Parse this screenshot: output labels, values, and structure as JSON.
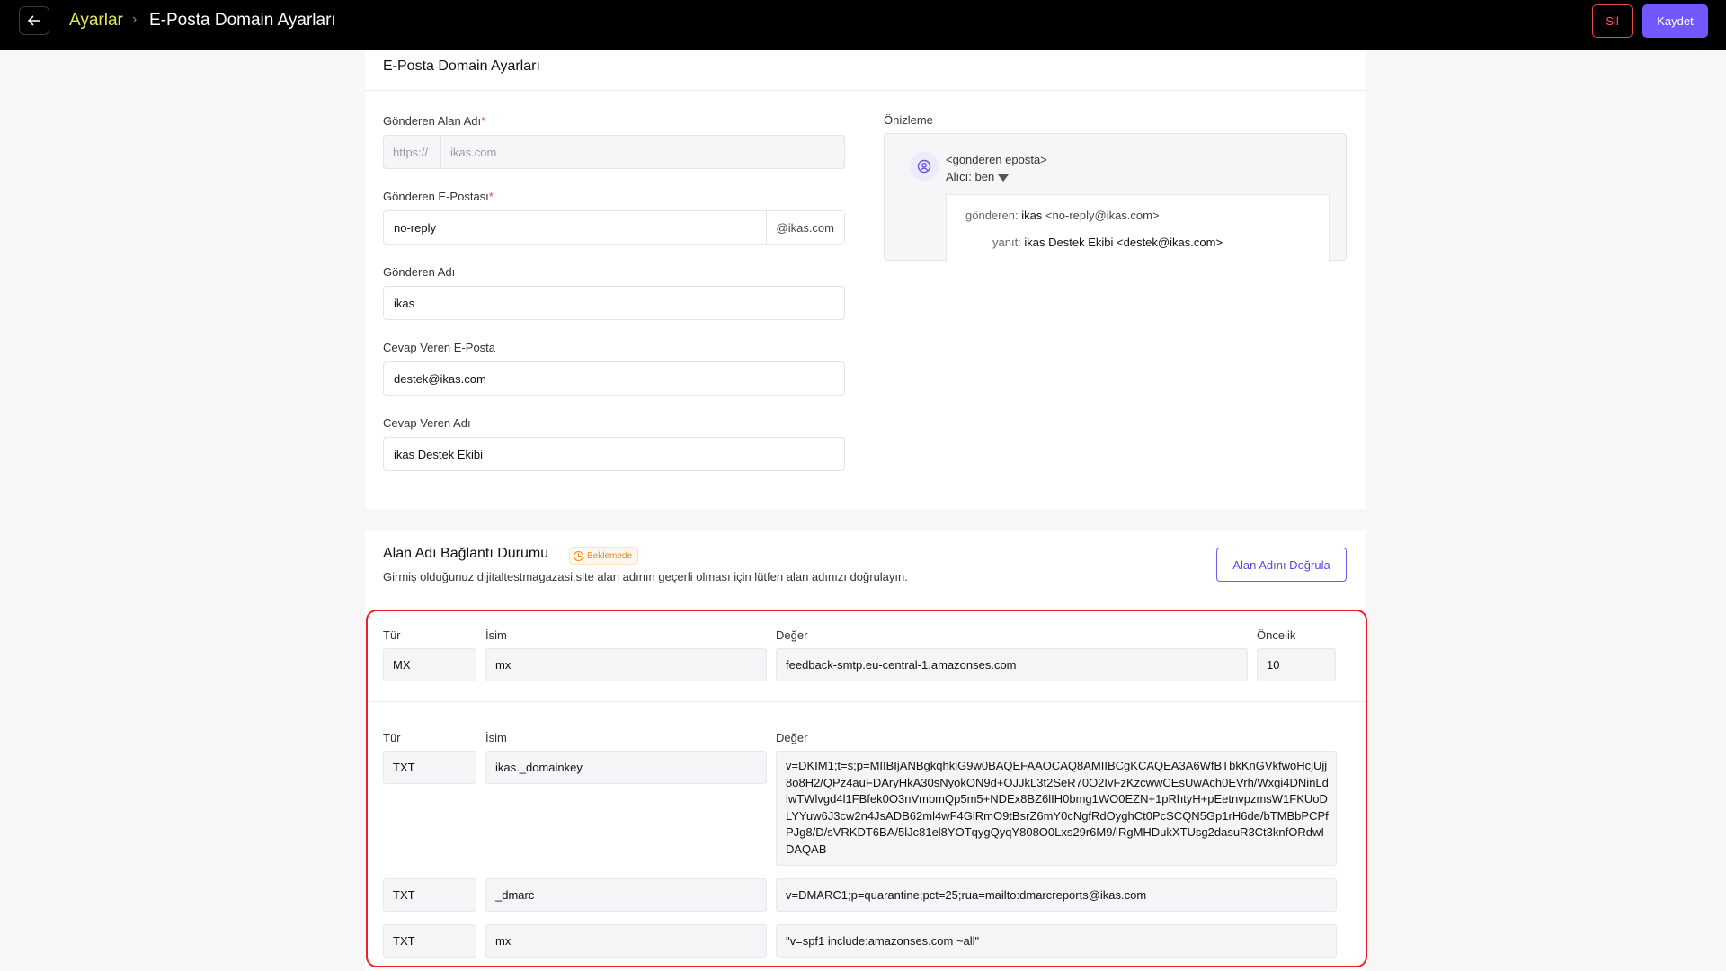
{
  "header": {
    "back_icon": "arrow-left-icon",
    "breadcrumb_parent": "Ayarlar",
    "breadcrumb_current": "E-Posta Domain Ayarları",
    "delete_label": "Sil",
    "save_label": "Kaydet"
  },
  "settings": {
    "title": "E-Posta Domain Ayarları",
    "sender_domain": {
      "label": "Gönderen Alan Adı",
      "required": "*",
      "prefix": "https://",
      "value": "ikas.com"
    },
    "sender_email": {
      "label": "Gönderen E-Postası",
      "required": "*",
      "value": "no-reply",
      "suffix": "@ikas.com"
    },
    "sender_name": {
      "label": "Gönderen Adı",
      "value": "ikas"
    },
    "reply_email": {
      "label": "Cevap Veren E-Posta",
      "value": "destek@ikas.com"
    },
    "reply_name": {
      "label": "Cevap Veren Adı",
      "value": "ikas Destek Ekibi"
    }
  },
  "preview": {
    "label": "Önizleme",
    "sender_placeholder": "<gönderen eposta>",
    "recipient": "Alıcı: ben",
    "from_key": "gönderen:",
    "from_name": "ikas",
    "from_email": "<no-reply@ikas.com>",
    "reply_key": "yanıt:",
    "reply_value": "ikas Destek Ekibi <destek@ikas.com>"
  },
  "domain_status": {
    "title": "Alan Adı Bağlantı Durumu",
    "badge": "Beklemede",
    "description": "Girmiş olduğunuz dijitaltestmagazasi.site alan adının geçerli olması için lütfen alan adınızı doğrulayın.",
    "verify_label": "Alan Adını Doğrula",
    "columns": {
      "type": "Tür",
      "name": "İsim",
      "value": "Değer",
      "priority": "Öncelik"
    },
    "mx_record": {
      "type": "MX",
      "name": "mx",
      "value": "feedback-smtp.eu-central-1.amazonses.com",
      "priority": "10"
    },
    "txt_records": [
      {
        "type": "TXT",
        "name": "ikas._domainkey",
        "value": "v=DKIM1;t=s;p=MIIBIjANBgkqhkiG9w0BAQEFAAOCAQ8AMIIBCgKCAQEA3A6WfBTbkKnGVkfwoHcjUjj8o8H2/QPz4auFDAryHkA30sNyokON9d+OJJkL3t2SeR70O2IvFzKzcwwCEsUwAch0EVrh/Wxgi4DNinLdlwTWlvgd4l1FBfek0O3nVmbmQp5m5+NDEx8BZ6lIH0bmg1WO0EZN+1pRhtyH+pEetnvpzmsW1FKUoDLYYuw6J3cw2n4JsADB62ml4wF4GlRmO9tBsrZ6mY0cNgfRdOyghCt0PcSCQN5Gp1rH6de/bTMBbPCPfPJg8/D/sVRKDT6BA/5lJc81el8YOTqygQyqY808O0Lxs29r6M9/lRgMHDukXTUsg2dasuR3Ct3knfORdwIDAQAB"
      },
      {
        "type": "TXT",
        "name": "_dmarc",
        "value": "v=DMARC1;p=quarantine;pct=25;rua=mailto:dmarcreports@ikas.com"
      },
      {
        "type": "TXT",
        "name": "mx",
        "value": "\"v=spf1 include:amazonses.com ~all\""
      }
    ]
  }
}
